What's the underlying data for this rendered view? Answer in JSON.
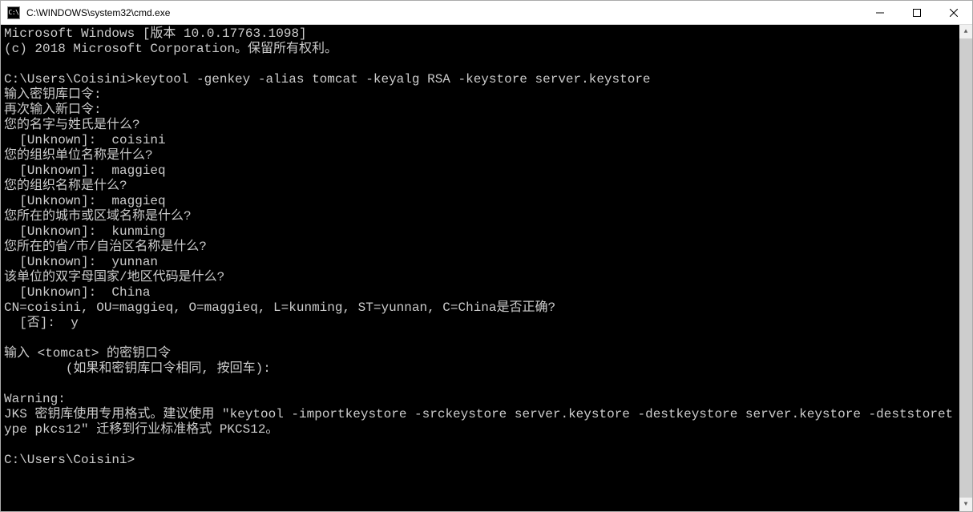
{
  "window": {
    "icon_label": "C:\\",
    "title": "C:\\WINDOWS\\system32\\cmd.exe"
  },
  "terminal": {
    "lines": [
      "Microsoft Windows [版本 10.0.17763.1098]",
      "(c) 2018 Microsoft Corporation。保留所有权利。",
      "",
      "C:\\Users\\Coisini>keytool -genkey -alias tomcat -keyalg RSA -keystore server.keystore",
      "输入密钥库口令:",
      "再次输入新口令:",
      "您的名字与姓氏是什么?",
      "  [Unknown]:  coisini",
      "您的组织单位名称是什么?",
      "  [Unknown]:  maggieq",
      "您的组织名称是什么?",
      "  [Unknown]:  maggieq",
      "您所在的城市或区域名称是什么?",
      "  [Unknown]:  kunming",
      "您所在的省/市/自治区名称是什么?",
      "  [Unknown]:  yunnan",
      "该单位的双字母国家/地区代码是什么?",
      "  [Unknown]:  China",
      "CN=coisini, OU=maggieq, O=maggieq, L=kunming, ST=yunnan, C=China是否正确?",
      "  [否]:  y",
      "",
      "输入 <tomcat> 的密钥口令",
      "        (如果和密钥库口令相同, 按回车):",
      "",
      "Warning:",
      "JKS 密钥库使用专用格式。建议使用 \"keytool -importkeystore -srckeystore server.keystore -destkeystore server.keystore -deststoretype pkcs12\" 迁移到行业标准格式 PKCS12。",
      "",
      "C:\\Users\\Coisini>"
    ]
  }
}
